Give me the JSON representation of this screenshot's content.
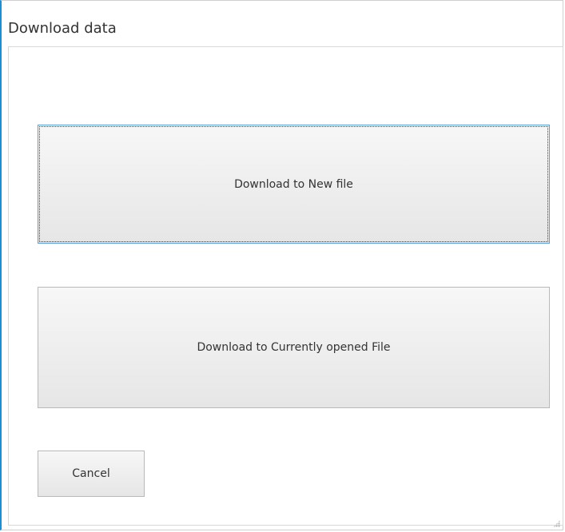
{
  "dialog": {
    "title": "Download data"
  },
  "buttons": {
    "download_new": "Download to New file",
    "download_current": "Download to Currently opened File",
    "cancel": "Cancel"
  }
}
